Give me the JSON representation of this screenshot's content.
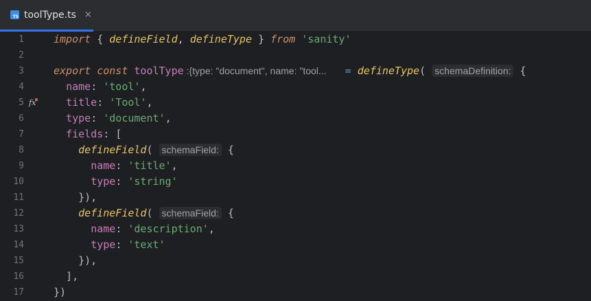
{
  "tab": {
    "icon_label": "TS",
    "title": "toolType.ts",
    "close": "×"
  },
  "gutter": {
    "lines": [
      "1",
      "2",
      "3",
      "4",
      "5",
      "6",
      "7",
      "8",
      "9",
      "10",
      "11",
      "12",
      "13",
      "14",
      "15",
      "16",
      "17"
    ],
    "fx_icon": "fx"
  },
  "code": {
    "l1": {
      "kw_import": "import",
      "p1": " { ",
      "f1": "defineField",
      "p2": ", ",
      "f2": "defineType",
      "p3": " } ",
      "kw_from": "from",
      "sp": " ",
      "s1": "'sanity'"
    },
    "l3": {
      "kw_export": "export",
      "sp1": " ",
      "kw_const": "const",
      "sp2": " ",
      "var": "toolType",
      "type_hint": " :{type: \"document\", name: \"tool...",
      "sp3": "   ",
      "eq": "=",
      "sp4": " ",
      "fn": "defineType",
      "paren": "(",
      "param_hint": "schemaDefinition:",
      "brace": " {"
    },
    "l4": {
      "indent": "  ",
      "prop": "name",
      "colon": ": ",
      "str": "'tool'",
      "end": ","
    },
    "l5": {
      "indent": "  ",
      "prop": "title",
      "colon": ": ",
      "str": "'Tool'",
      "end": ","
    },
    "l6": {
      "indent": "  ",
      "prop": "type",
      "colon": ": ",
      "str": "'document'",
      "end": ","
    },
    "l7": {
      "indent": "  ",
      "prop": "fields",
      "colon": ": ",
      "end": "["
    },
    "l8": {
      "indent": "    ",
      "fn": "defineField",
      "paren": "(",
      "param_hint": "schemaField:",
      "brace": " {"
    },
    "l9": {
      "indent": "      ",
      "prop": "name",
      "colon": ": ",
      "str": "'title'",
      "end": ","
    },
    "l10": {
      "indent": "      ",
      "prop": "type",
      "colon": ": ",
      "str": "'string'",
      "end": ""
    },
    "l11": {
      "text": "    }),"
    },
    "l12": {
      "indent": "    ",
      "fn": "defineField",
      "paren": "(",
      "param_hint": "schemaField:",
      "brace": " {"
    },
    "l13": {
      "indent": "      ",
      "prop": "name",
      "colon": ": ",
      "str": "'description'",
      "end": ","
    },
    "l14": {
      "indent": "      ",
      "prop": "type",
      "colon": ": ",
      "str": "'text'",
      "end": ""
    },
    "l15": {
      "text": "    }),"
    },
    "l16": {
      "text": "  ],"
    },
    "l17": {
      "text": "})"
    }
  }
}
